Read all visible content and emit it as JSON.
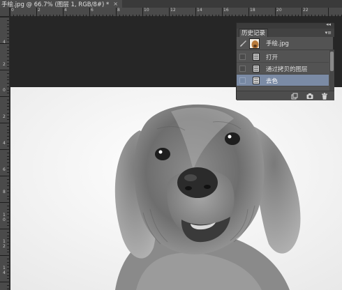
{
  "document_tab": {
    "title": "手绘.jpg @ 66.7% (图层 1, RGB/8#) *",
    "close_glyph": "×"
  },
  "ruler_top": {
    "labels": [
      "0",
      "2",
      "4",
      "6",
      "8",
      "10",
      "12",
      "14",
      "16",
      "18",
      "20",
      "22"
    ]
  },
  "ruler_left": {
    "labels": [
      "4",
      "2",
      "0",
      "2",
      "4",
      "6",
      "8",
      "1\n0",
      "1\n2",
      "1\n4"
    ]
  },
  "history_panel": {
    "collapse_glyph": "◂◂",
    "tab_label": "历史记录",
    "menu_glyph": "▾≡",
    "snapshot_label": "手绘.jpg",
    "items": [
      {
        "label": "打开"
      },
      {
        "label": "通过拷贝的图层"
      },
      {
        "label": "去色"
      }
    ],
    "active_index": 2,
    "footer_icons": [
      "new-document-from-state-icon",
      "camera-icon",
      "trash-icon"
    ]
  },
  "colors": {
    "panel_bg": "#535353",
    "active_row": "#7b8ba5",
    "canvas_bg": "#262626",
    "image_bg": "#f2f2f2"
  }
}
